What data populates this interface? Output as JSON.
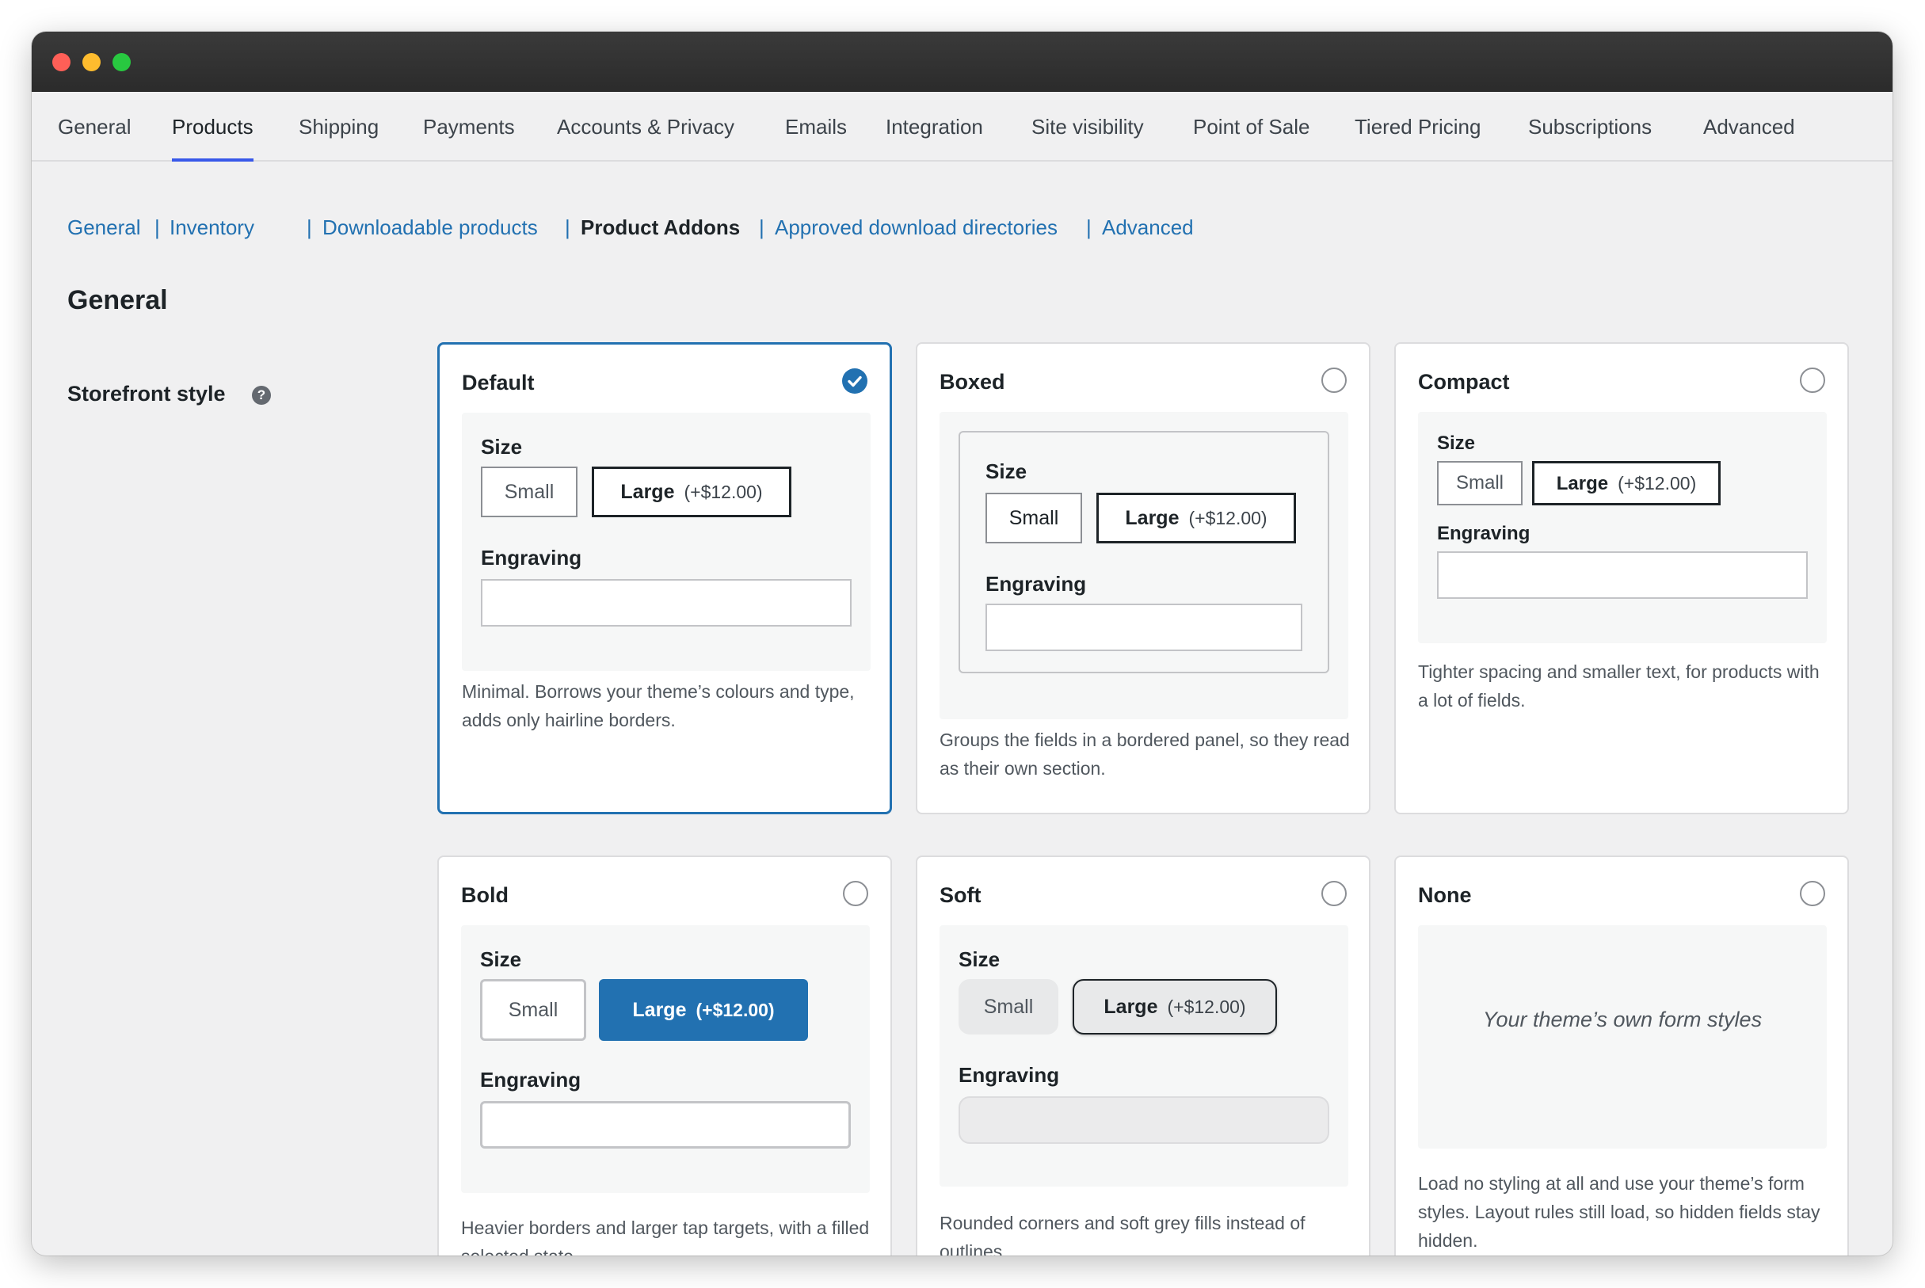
{
  "tabs": [
    "General",
    "Products",
    "Shipping",
    "Payments",
    "Accounts & Privacy",
    "Emails",
    "Integration",
    "Site visibility",
    "Point of Sale",
    "Tiered Pricing",
    "Subscriptions",
    "Advanced"
  ],
  "active_tab": "Products",
  "subnav": {
    "items": [
      "General",
      "Inventory",
      "Downloadable products",
      "Product Addons",
      "Approved download directories",
      "Advanced"
    ],
    "current": "Product Addons",
    "separator": "|"
  },
  "section_title": "General",
  "field": {
    "label": "Storefront style",
    "help_icon": "?"
  },
  "preview_labels": {
    "size": "Size",
    "small": "Small",
    "large": "Large",
    "large_price": "(+$12.00)",
    "engraving": "Engraving"
  },
  "styles": [
    {
      "name": "Default",
      "selected": true,
      "description": "Minimal. Borrows your theme’s colours and type, adds only hairline borders."
    },
    {
      "name": "Boxed",
      "selected": false,
      "description": "Groups the fields in a bordered panel, so they read as their own section."
    },
    {
      "name": "Compact",
      "selected": false,
      "description": "Tighter spacing and smaller text, for products with a lot of fields."
    },
    {
      "name": "Bold",
      "selected": false,
      "description": "Heavier borders and larger tap targets, with a filled selected state."
    },
    {
      "name": "Soft",
      "selected": false,
      "description": "Rounded corners and soft grey fills instead of outlines."
    },
    {
      "name": "None",
      "selected": false,
      "description": "Load no styling at all and use your theme’s form styles. Layout rules still load, so hidden fields stay hidden.",
      "preview_note": "Your theme’s own form styles"
    }
  ],
  "colors": {
    "accent": "#2271b1",
    "tab_underline": "#3858e9",
    "link": "#2271b1",
    "titlebar": "#2f2f2f"
  }
}
